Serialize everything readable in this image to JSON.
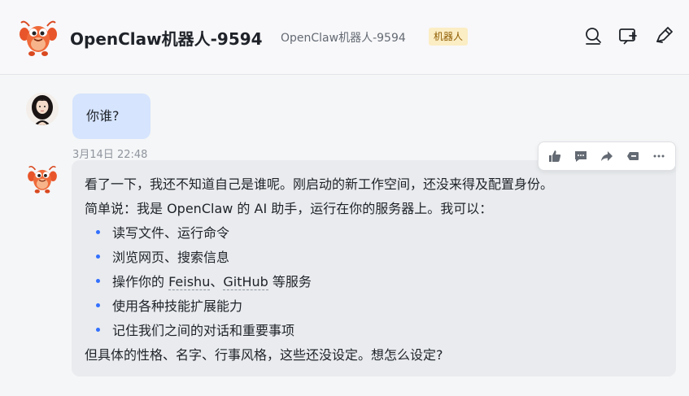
{
  "header": {
    "title": "OpenClaw机器人-9594",
    "subtitle": "OpenClaw机器人-9594",
    "badge": "机器人",
    "icons": [
      "search-icon",
      "add-group-icon",
      "edit-icon"
    ]
  },
  "messages": {
    "user": {
      "text": "你谁?",
      "bubble_color": "#d6e4fd"
    },
    "timestamp": "3月14日 22:48",
    "bot": {
      "intro": "看了一下，我还不知道自己是谁呢。刚启动的新工作空间，还没来得及配置身份。",
      "summary": "简单说：我是 OpenClaw 的 AI 助手，运行在你的服务器上。我可以：",
      "bullets": {
        "b0": "读写文件、运行命令",
        "b1": "浏览网页、搜索信息",
        "b2_pre": "操作你的 ",
        "b2_feishu": "Feishu",
        "b2_sep": "、",
        "b2_github": "GitHub",
        "b2_post": " 等服务",
        "b3": "使用各种技能扩展能力",
        "b4": "记住我们之间的对话和重要事项"
      },
      "closing": "但具体的性格、名字、行事风格，这些还没设定。想怎么设定?",
      "bubble_color": "#e9ebee"
    }
  },
  "toolbar": {
    "actions": [
      "thumbs-up-icon",
      "comment-icon",
      "forward-icon",
      "quote-icon",
      "more-icon"
    ]
  },
  "colors": {
    "accent": "#3370ff",
    "badge_bg": "#fbedc4",
    "badge_text": "#8f5c00"
  }
}
